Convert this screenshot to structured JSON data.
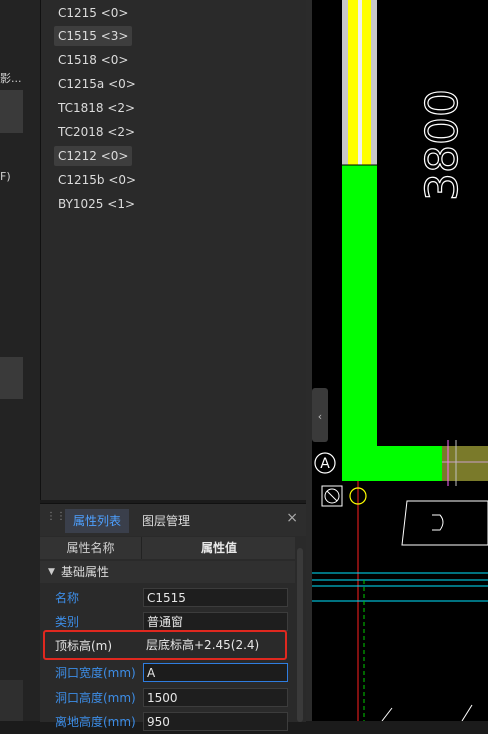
{
  "left_strip": {
    "text_top": "影...",
    "text_mid": "F)"
  },
  "component_list": [
    {
      "label": "C1215 <0>",
      "selected": false
    },
    {
      "label": "C1515 <3>",
      "selected": true
    },
    {
      "label": "C1518 <0>",
      "selected": false
    },
    {
      "label": "C1215a <0>",
      "selected": false
    },
    {
      "label": "TC1818 <2>",
      "selected": false
    },
    {
      "label": "TC2018 <2>",
      "selected": false
    },
    {
      "label": "C1212 <0>",
      "selected": true
    },
    {
      "label": "C1215b <0>",
      "selected": false
    },
    {
      "label": "BY1025 <1>",
      "selected": false
    }
  ],
  "properties_panel": {
    "tab_properties": "属性列表",
    "tab_layers": "图层管理",
    "close": "×",
    "header_name": "属性名称",
    "header_value": "属性值",
    "group": "基础属性",
    "rows": [
      {
        "name": "名称",
        "value": "C1515",
        "name_color": "blue"
      },
      {
        "name": "类别",
        "value": "普通窗",
        "name_color": "blue"
      },
      {
        "name": "顶标高(m)",
        "value": "层底标高+2.45(2.4)",
        "name_color": "plain"
      },
      {
        "name": "洞口宽度(mm)",
        "value": "A",
        "name_color": "blue"
      },
      {
        "name": "洞口高度(mm)",
        "value": "1500",
        "name_color": "blue"
      },
      {
        "name": "离地高度(mm)",
        "value": "950",
        "name_color": "blue"
      }
    ]
  },
  "cad": {
    "dimension_text": "3800",
    "axis_label": "A",
    "colors": {
      "wall_green": "#00ff00",
      "window_yellow": "#ffff00",
      "highlight_red": "#e0281f",
      "accent_blue": "#3d8ee8"
    }
  }
}
